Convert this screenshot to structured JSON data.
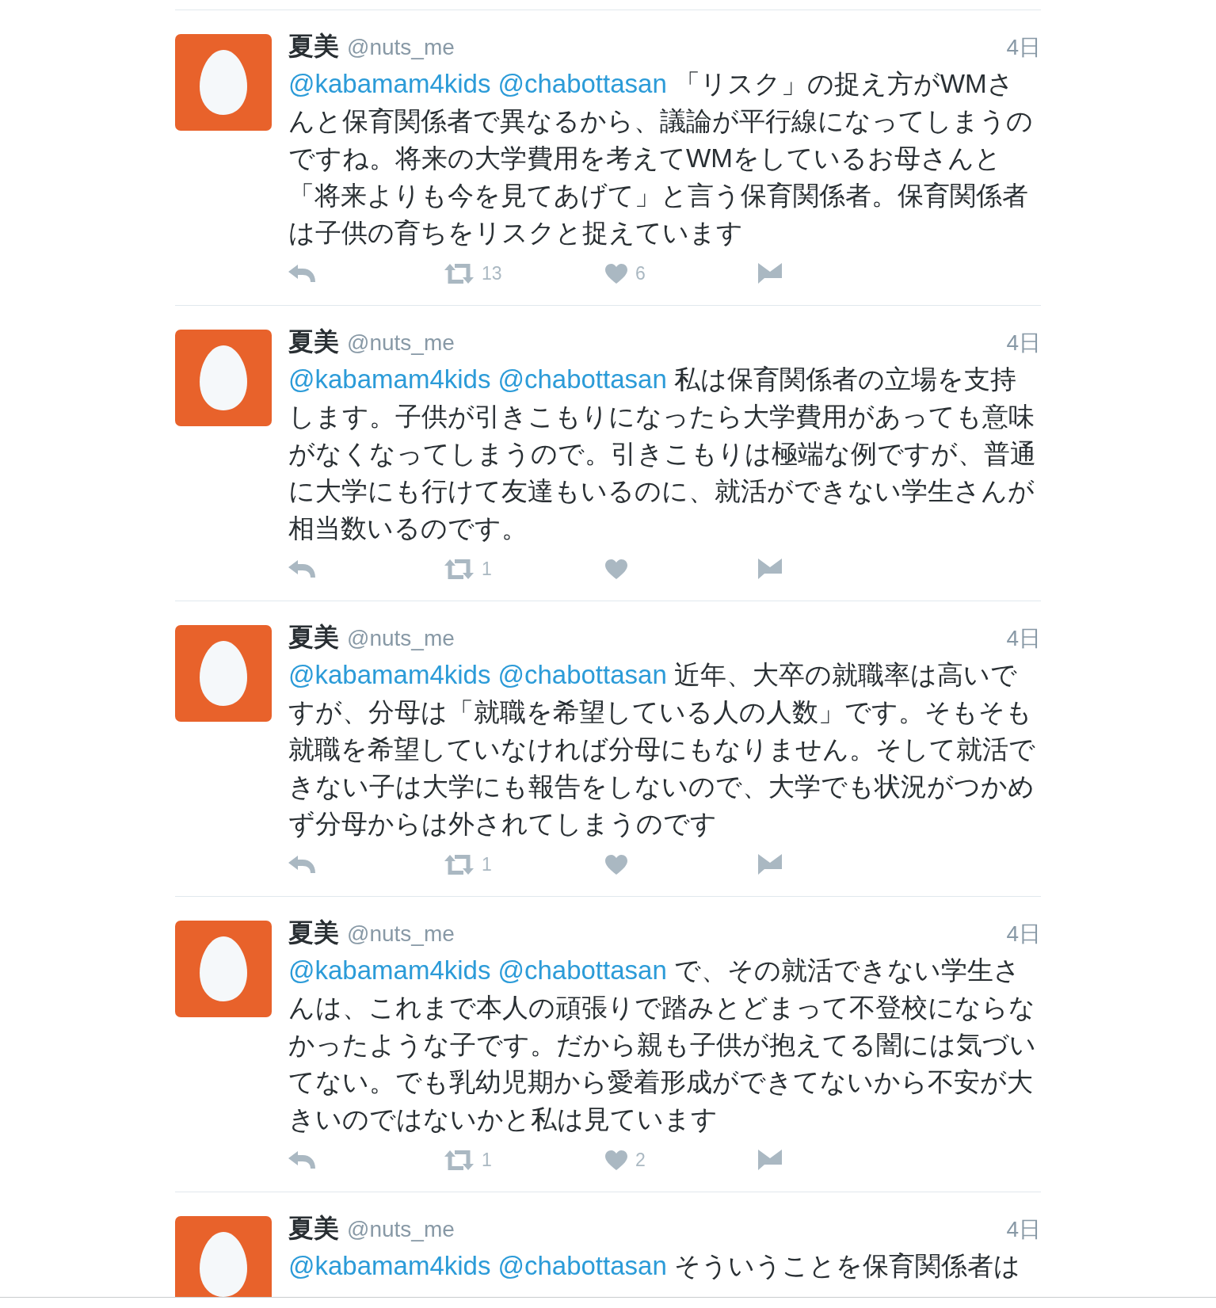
{
  "tweets": [
    {
      "name": "夏美",
      "handle": "@nuts_me",
      "time": "4日",
      "mentions": [
        "@kabamam4kids",
        "@chabottasan"
      ],
      "lines": [
        "「リスク」の捉え方がWMさ",
        "んと保育関係者で異なるから、議論が平行線になってしまうの",
        "ですね。将来の大学費用を考えてWMをしているお母さんと",
        "「将来よりも今を見てあげて」と言う保育関係者。保育関係者",
        "は子供の育ちをリスクと捉えています"
      ],
      "actions": {
        "retweets": "13",
        "likes": "6"
      }
    },
    {
      "name": "夏美",
      "handle": "@nuts_me",
      "time": "4日",
      "mentions": [
        "@kabamam4kids",
        "@chabottasan"
      ],
      "lines": [
        "私は保育関係者の立場を支持",
        "します。子供が引きこもりになったら大学費用があっても意味",
        "がなくなってしまうので。引きこもりは極端な例ですが、普通",
        "に大学にも行けて友達もいるのに、就活ができない学生さんが",
        "相当数いるのです。"
      ],
      "actions": {
        "retweets": "1"
      }
    },
    {
      "name": "夏美",
      "handle": "@nuts_me",
      "time": "4日",
      "mentions": [
        "@kabamam4kids",
        "@chabottasan"
      ],
      "lines": [
        "近年、大卒の就職率は高いで",
        "すが、分母は「就職を希望している人の人数」です。そもそも",
        "就職を希望していなければ分母にもなりません。そして就活で",
        "きない子は大学にも報告をしないので、大学でも状況がつかめ",
        "ず分母からは外されてしまうのです"
      ],
      "actions": {
        "retweets": "1"
      }
    },
    {
      "name": "夏美",
      "handle": "@nuts_me",
      "time": "4日",
      "mentions": [
        "@kabamam4kids",
        "@chabottasan"
      ],
      "lines": [
        "で、その就活できない学生さ",
        "んは、これまで本人の頑張りで踏みとどまって不登校にならな",
        "かったような子です。だから親も子供が抱えてる闇には気づい",
        "てない。でも乳幼児期から愛着形成ができてないから不安が大",
        "きいのではないかと私は見ています"
      ],
      "actions": {
        "retweets": "1",
        "likes": "2"
      }
    },
    {
      "name": "夏美",
      "handle": "@nuts_me",
      "time": "4日",
      "mentions": [
        "@kabamam4kids",
        "@chabottasan"
      ],
      "lines": [
        "そういうことを保育関係者は"
      ]
    }
  ]
}
